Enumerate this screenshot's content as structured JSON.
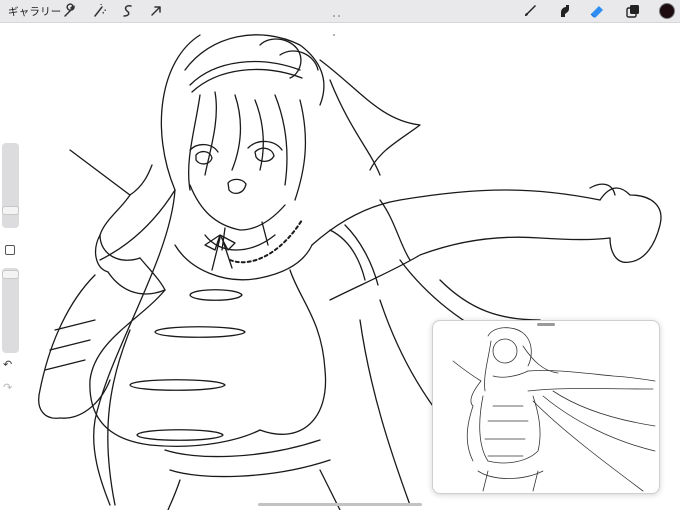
{
  "toolbar": {
    "gallery_label": "ギャラリー",
    "left_icons": [
      "wrench-icon",
      "magic-wand-icon",
      "selection-icon",
      "transform-arrow-icon"
    ],
    "right_icons": [
      "brush-icon",
      "smudge-icon",
      "eraser-icon",
      "layers-icon",
      "color-icon"
    ],
    "active_tool": "eraser",
    "accent": "#2e8ef3",
    "current_color": "#1d0b10"
  },
  "sidebar": {
    "brush_size_level": 0.55,
    "opacity_level": 0.05,
    "modify_icon": "square-icon",
    "undo_icon": "undo-icon",
    "redo_icon": "redo-icon"
  },
  "reference_window": {
    "content": "line-art-reference-thumbnail"
  }
}
